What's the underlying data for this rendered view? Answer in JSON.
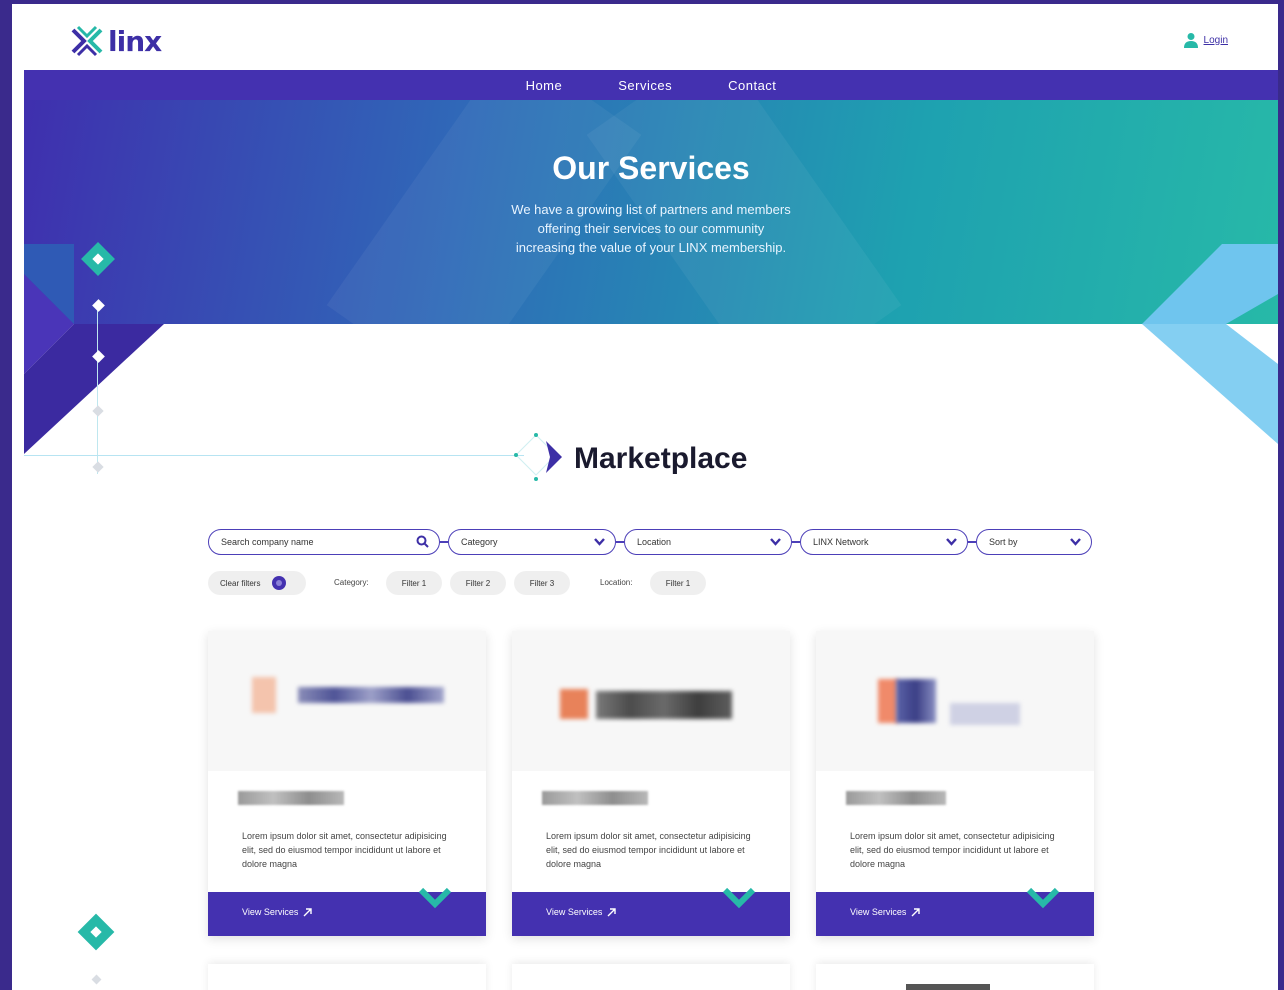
{
  "brand": {
    "name": "linx",
    "primary": "#4431b0",
    "accent": "#27b9a8"
  },
  "header": {
    "login_label": "Login",
    "login_icon": "user-icon"
  },
  "nav": {
    "items": [
      "Home",
      "Services",
      "Contact"
    ]
  },
  "hero": {
    "title": "Our Services",
    "subtitle_lines": [
      "We have a growing list of partners and members",
      "offering their services to our community",
      "increasing the value of your LINX membership."
    ]
  },
  "marketplace": {
    "title": "Marketplace"
  },
  "filters": {
    "search_placeholder": "Search company name",
    "dropdowns": [
      "Category",
      "Location",
      "LINX Network",
      "Sort by"
    ]
  },
  "active_filters": {
    "clear_label": "Clear filters",
    "category_label": "Category:",
    "category_chips": [
      "Filter 1",
      "Filter 2",
      "Filter 3"
    ],
    "location_label": "Location:",
    "location_chips": [
      "Filter 1"
    ]
  },
  "cards": [
    {
      "description": "Lorem ipsum dolor sit amet, consectetur adipisicing elit, sed do eiusmod tempor incididunt ut labore et dolore magna",
      "cta": "View Services"
    },
    {
      "description": "Lorem ipsum dolor sit amet, consectetur adipisicing elit, sed do eiusmod tempor incididunt ut labore et dolore magna",
      "cta": "View Services"
    },
    {
      "description": "Lorem ipsum dolor sit amet, consectetur adipisicing elit, sed do eiusmod tempor incididunt ut labore et dolore magna",
      "cta": "View Services"
    }
  ]
}
